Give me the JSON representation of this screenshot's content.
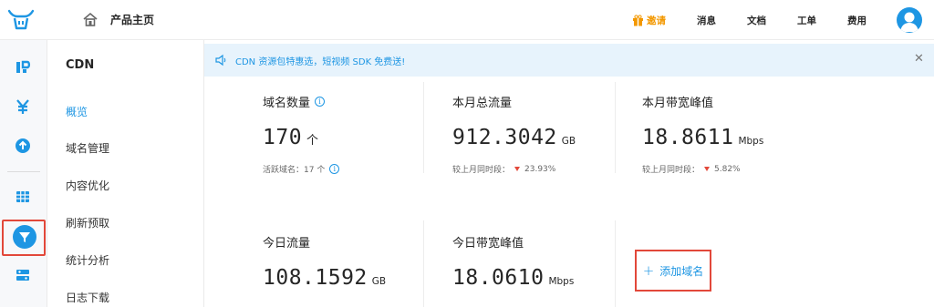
{
  "header": {
    "page_title": "产品主页",
    "nav": [
      {
        "key": "invite",
        "label": "邀请"
      },
      {
        "key": "messages",
        "label": "消息"
      },
      {
        "key": "docs",
        "label": "文档"
      },
      {
        "key": "tickets",
        "label": "工单"
      },
      {
        "key": "billing",
        "label": "费用"
      }
    ],
    "colors": {
      "accent": "#1e96e3",
      "invite": "#f39800",
      "highlight": "#e2483a"
    }
  },
  "rail": {
    "icons": [
      "dashboard-icon",
      "yen-icon",
      "upload-icon",
      "grid-icon",
      "cdn-filter-icon",
      "settings-list-icon"
    ]
  },
  "subnav": {
    "title": "CDN",
    "items": [
      {
        "label": "概览",
        "active": true
      },
      {
        "label": "域名管理"
      },
      {
        "label": "内容优化"
      },
      {
        "label": "刷新预取"
      },
      {
        "label": "统计分析"
      },
      {
        "label": "日志下载"
      }
    ]
  },
  "notice": {
    "text": "CDN 资源包特惠选，短视频 SDK 免费送!"
  },
  "stats": {
    "domains": {
      "label": "域名数量",
      "value": "170",
      "unit": "个",
      "sub": "活跃域名：17 个"
    },
    "month_traffic": {
      "label": "本月总流量",
      "value": "912.3042",
      "unit": "GB",
      "sub_prefix": "较上月同时段：",
      "sub_pct": "23.93%"
    },
    "month_peak": {
      "label": "本月带宽峰值",
      "value": "18.8611",
      "unit": "Mbps",
      "sub_prefix": "较上月同时段：",
      "sub_pct": "5.82%"
    },
    "today_traffic": {
      "label": "今日流量",
      "value": "108.1592",
      "unit": "GB"
    },
    "today_peak": {
      "label": "今日带宽峰值",
      "value": "18.0610",
      "unit": "Mbps"
    }
  },
  "add_domain": {
    "label": "添加域名"
  }
}
